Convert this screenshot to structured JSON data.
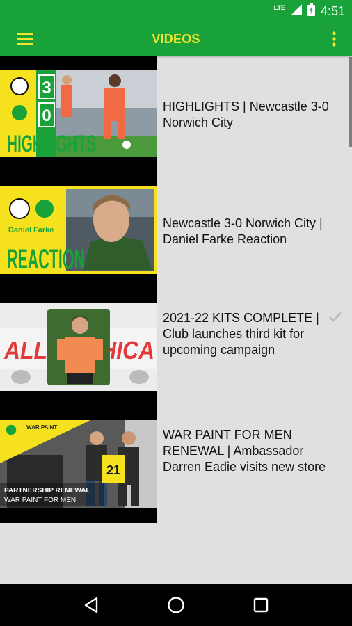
{
  "status_bar": {
    "network": "LTE",
    "time": "4:51"
  },
  "app_bar": {
    "title": "VIDEOS"
  },
  "colors": {
    "brand_green": "#1aa23a",
    "brand_yellow": "#f5e52a"
  },
  "videos": [
    {
      "title": "HIGHLIGHTS | Newcastle 3-0 Norwich City",
      "thumb_text": {
        "score_top": "3",
        "score_bottom": "0",
        "headline": "HIGHLIGHTS"
      }
    },
    {
      "title": "Newcastle 3-0 Norwich City | Daniel Farke Reaction",
      "thumb_text": {
        "name": "Daniel Farke",
        "headline": "REACTION"
      }
    },
    {
      "title": "2021-22 KITS COMPLETE | Club launches third kit for upcoming campaign",
      "thumb_text": {
        "banner": "ALLIN ... HICA"
      },
      "watched_icon": "checkmark-icon"
    },
    {
      "title": "WAR PAINT FOR MEN RENEWAL | Ambassador Darren Eadie visits new store",
      "thumb_text": {
        "brand": "WAR PAINT",
        "line1": "PARTNERSHIP RENEWAL",
        "line2": "WAR PAINT FOR MEN",
        "shirt_number": "21"
      }
    }
  ]
}
